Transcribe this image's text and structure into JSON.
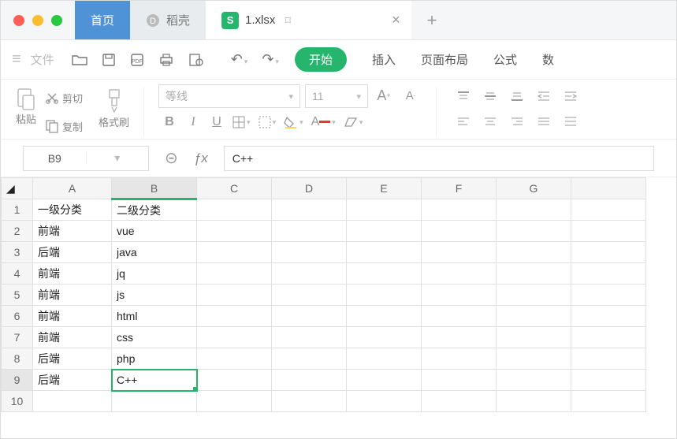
{
  "titlebar": {
    "traffic": {
      "close": "#ff5f57",
      "min": "#febc2e",
      "max": "#28c840"
    },
    "home_tab": "首页",
    "second_tab": "稻壳",
    "file_tab": "1.xlsx",
    "new_tab": "+"
  },
  "toolbar1": {
    "file": "文件",
    "menus": {
      "start": "开始",
      "insert": "插入",
      "layout": "页面布局",
      "formula": "公式",
      "data": "数"
    }
  },
  "ribbon": {
    "paste": "粘贴",
    "cut": "剪切",
    "copy": "复制",
    "brush": "格式刷",
    "font_name": "等线",
    "font_size": "11",
    "B": "B",
    "I": "I",
    "U": "U"
  },
  "fx": {
    "cell": "B9",
    "symbol": "ƒx",
    "value": "C++"
  },
  "grid": {
    "cols": [
      "A",
      "B",
      "C",
      "D",
      "E",
      "F",
      "G"
    ],
    "rows": [
      {
        "n": "1",
        "c": [
          "一级分类",
          "二级分类",
          "",
          "",
          "",
          "",
          ""
        ]
      },
      {
        "n": "2",
        "c": [
          "前端",
          "vue",
          "",
          "",
          "",
          "",
          ""
        ]
      },
      {
        "n": "3",
        "c": [
          "后端",
          "java",
          "",
          "",
          "",
          "",
          ""
        ]
      },
      {
        "n": "4",
        "c": [
          "前端",
          "jq",
          "",
          "",
          "",
          "",
          ""
        ]
      },
      {
        "n": "5",
        "c": [
          "前端",
          "js",
          "",
          "",
          "",
          "",
          ""
        ]
      },
      {
        "n": "6",
        "c": [
          "前端",
          "html",
          "",
          "",
          "",
          "",
          ""
        ]
      },
      {
        "n": "7",
        "c": [
          "前端",
          "css",
          "",
          "",
          "",
          "",
          ""
        ]
      },
      {
        "n": "8",
        "c": [
          "后端",
          "php",
          "",
          "",
          "",
          "",
          ""
        ]
      },
      {
        "n": "9",
        "c": [
          "后端",
          "C++",
          "",
          "",
          "",
          "",
          ""
        ]
      },
      {
        "n": "10",
        "c": [
          "",
          "",
          "",
          "",
          "",
          "",
          ""
        ]
      }
    ],
    "selected": {
      "row": 9,
      "col": 1
    }
  }
}
